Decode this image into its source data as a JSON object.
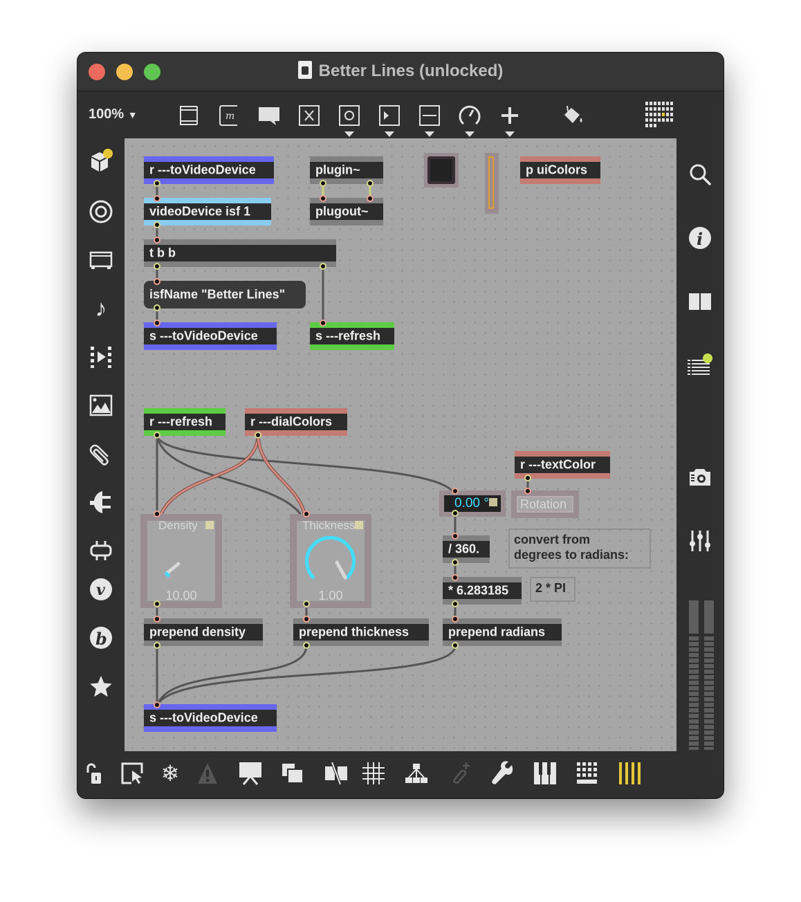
{
  "window": {
    "title": "Better Lines (unlocked)",
    "traffic_lights": [
      "close",
      "minimize",
      "zoom"
    ],
    "colors": {
      "close": "#ed6a5e",
      "minimize": "#f5bf4f",
      "zoom": "#61c554"
    }
  },
  "toolbar": {
    "zoom_level": "100%",
    "items": [
      {
        "icon": "presentation-icon"
      },
      {
        "icon": "message-box-icon",
        "glyph": "m"
      },
      {
        "icon": "comment-icon"
      },
      {
        "icon": "toggle-icon"
      },
      {
        "icon": "button-icon",
        "has_menu": true
      },
      {
        "icon": "number-box-icon",
        "has_menu": true
      },
      {
        "icon": "slider-icon",
        "has_menu": true
      },
      {
        "icon": "dial-icon",
        "has_menu": true
      },
      {
        "icon": "plus-icon",
        "has_menu": true
      },
      {
        "icon": "paint-bucket-icon"
      },
      {
        "icon": "grid-icon"
      }
    ]
  },
  "left_sidebar": [
    {
      "icon": "packages-icon",
      "badge": "#e4c83a"
    },
    {
      "icon": "target-icon"
    },
    {
      "icon": "video-icon"
    },
    {
      "icon": "music-note-icon"
    },
    {
      "icon": "media-clip-icon"
    },
    {
      "icon": "image-icon"
    },
    {
      "icon": "paperclip-icon"
    },
    {
      "icon": "plug-icon"
    },
    {
      "icon": "connector-icon"
    },
    {
      "icon": "vizzie-icon",
      "glyph": "v"
    },
    {
      "icon": "beap-icon",
      "glyph": "b"
    },
    {
      "icon": "favorites-star-icon"
    }
  ],
  "right_sidebar": [
    {
      "icon": "search-icon"
    },
    {
      "icon": "info-icon",
      "glyph": "i"
    },
    {
      "icon": "split-view-icon"
    },
    {
      "icon": "console-list-icon",
      "badge": "#c8e050"
    },
    {
      "icon": "snapshot-camera-icon"
    },
    {
      "icon": "mixer-sliders-icon"
    },
    {
      "icon": "audio-meter-icon"
    }
  ],
  "bottom_bar": [
    {
      "icon": "lock-open-icon"
    },
    {
      "icon": "presentation-mode-icon"
    },
    {
      "icon": "freeze-snowflake-icon"
    },
    {
      "icon": "warning-icon",
      "disabled": true
    },
    {
      "icon": "presentation-stand-icon"
    },
    {
      "icon": "bring-to-front-icon"
    },
    {
      "icon": "hide-on-lock-icon"
    },
    {
      "icon": "grid-snap-icon"
    },
    {
      "icon": "hierarchy-icon"
    },
    {
      "icon": "add-dependency-icon",
      "disabled": true
    },
    {
      "icon": "wrench-icon"
    },
    {
      "icon": "piano-keys-icon"
    },
    {
      "icon": "keyboard-icon"
    },
    {
      "icon": "mixer-bars-icon",
      "color": "#e4c83a"
    }
  ],
  "patch": {
    "objects": {
      "r_toVideoDevice": "r ---toVideoDevice",
      "videoDevice": "videoDevice isf 1",
      "tbb": "t b b",
      "isfName": "isfName \"Better Lines\"",
      "s_toVideoDevice_top": "s ---toVideoDevice",
      "plugin": "plugin~",
      "plugout": "plugout~",
      "p_uiColors": "p uiColors",
      "s_refresh": "s ---refresh",
      "r_refresh": "r ---refresh",
      "r_dialColors": "r ---dialColors",
      "r_textColor": "r ---textColor",
      "div360": "/ 360.",
      "mul2pi": "* 6.283185",
      "prepend_density": "prepend density",
      "prepend_thickness": "prepend thickness",
      "prepend_radians": "prepend radians",
      "s_toVideoDevice_bottom": "s ---toVideoDevice"
    },
    "comments": {
      "convert": "convert from\ndegrees to radians:",
      "two_pi": "2 * PI"
    },
    "dials": {
      "density": {
        "label": "Density",
        "value": "10.00",
        "fraction": 0.0
      },
      "thickness": {
        "label": "Thickness",
        "value": "1.00",
        "fraction": 1.0
      }
    },
    "number_box": {
      "value": "0.00 °"
    },
    "rotation_label": "Rotation",
    "colors": {
      "send_receive_video": "#6666ee",
      "videoDevice": "#88ccf0",
      "refresh": "#5ccc44",
      "colors_bus": "#c47c72",
      "dial_accent": "#44ddff",
      "level_fill": "#e0a030"
    }
  }
}
